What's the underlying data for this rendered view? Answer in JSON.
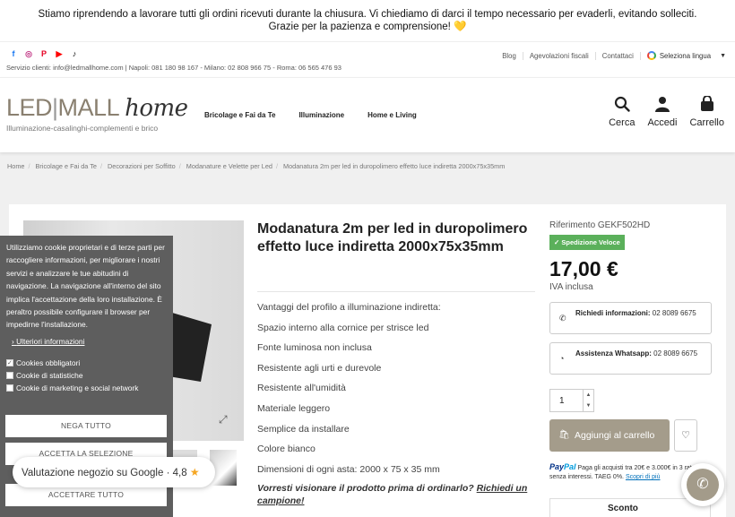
{
  "announcement": {
    "line1": "Stiamo riprendendo a lavorare tutti gli ordini ricevuti durante la chiusura. Vi chiediamo di darci il tempo necessario per evaderli, evitando solleciti.",
    "line2": "Grazie per la pazienza e comprensione! 💛"
  },
  "topbar": {
    "social": [
      {
        "icon": "facebook-icon",
        "glyph": "f",
        "color": "#1877f2"
      },
      {
        "icon": "instagram-icon",
        "glyph": "◎",
        "color": "#c13584"
      },
      {
        "icon": "pinterest-icon",
        "glyph": "P",
        "color": "#e60023"
      },
      {
        "icon": "youtube-icon",
        "glyph": "▶",
        "color": "#ff0000"
      },
      {
        "icon": "tiktok-icon",
        "glyph": "♪",
        "color": "#000000"
      }
    ],
    "service": "Servizio clienti: info@ledmallhome.com | Napoli: 081 180 98 167 - Milano: 02 808 966 75 - Roma: 06 565 476 93",
    "links": [
      "Blog",
      "Agevolazioni fiscali",
      "Contattaci"
    ],
    "language": "Seleziona lingua",
    "language_caret": "▼"
  },
  "header": {
    "logo_led": "LED",
    "logo_bar": "|",
    "logo_mall": "MALL",
    "logo_home": "home",
    "tagline": "Illuminazione-casalinghi-complementi e brico",
    "nav": [
      "Bricolage e Fai da Te",
      "Illuminazione",
      "Home e Living"
    ],
    "search_label": "Cerca",
    "account_label": "Accedi",
    "cart_label": "Carrello"
  },
  "breadcrumb": [
    "Home",
    "Bricolage e Fai da Te",
    "Decorazioni per Soffitto",
    "Modanature e Velette per Led",
    "Modanatura 2m per led in duropolimero effetto luce indiretta 2000x75x35mm"
  ],
  "product": {
    "title": "Modanatura 2m per led in duropolimero effetto luce indiretta 2000x75x35mm",
    "features": [
      "Vantaggi del profilo a illuminazione indiretta:",
      "Spazio interno alla cornice per strisce led",
      "Fonte luminosa non inclusa",
      "Resistente agli urti e durevole",
      "Resistente all'umidità",
      "Materiale leggero",
      "Semplice da installare",
      "Colore bianco",
      "Dimensioni di ogni asta: 2000 x 75 x 35 mm"
    ],
    "preview_text": "Vorresti visionare il prodotto prima di ordinarlo?",
    "preview_link": "Richiedi un campione!",
    "reference": "Riferimento GEKF502HD",
    "shipping_badge": "Spedizione Veloce",
    "price": "17,00 €",
    "vat": "IVA inclusa",
    "info_label": "Richiedi informazioni:",
    "info_number": "02 8089 6675",
    "whatsapp_label": "Assistenza Whatsapp:",
    "whatsapp_number": "02 8089 6675",
    "quantity": "1",
    "add_to_cart": "Aggiungi al carrello",
    "paypal_brand_a": "Pay",
    "paypal_brand_b": "Pal",
    "paypal_text": "Paga gli acquisti tra 20€ e 3.000€ in 3 rate senza interessi. TAEG 0%.",
    "paypal_link": "Scopri di più",
    "discount_header": "Sconto"
  },
  "cookie": {
    "text": "Utilizziamo cookie proprietari e di terze parti per raccogliere informazioni, per migliorare i nostri servizi e analizzare le tue abitudini di navigazione. La navigazione all'interno del sito implica l'accettazione della loro installazione. È peraltro possibile configurare il browser per impedirne l'installazione.",
    "more": "Ulteriori informazioni",
    "options": [
      {
        "label": "Cookies obbligatori",
        "checked": true
      },
      {
        "label": "Cookie di statistiche",
        "checked": false
      },
      {
        "label": "Cookie di marketing e social network",
        "checked": false
      }
    ],
    "deny": "NEGA TUTTO",
    "accept_selection": "ACCETTA LA SELEZIONE",
    "accept_all": "ACCETTARE TUTTO"
  },
  "rating": {
    "label": "Valutazione negozio",
    "source": "su Google",
    "dot": "·",
    "score": "4,8"
  }
}
